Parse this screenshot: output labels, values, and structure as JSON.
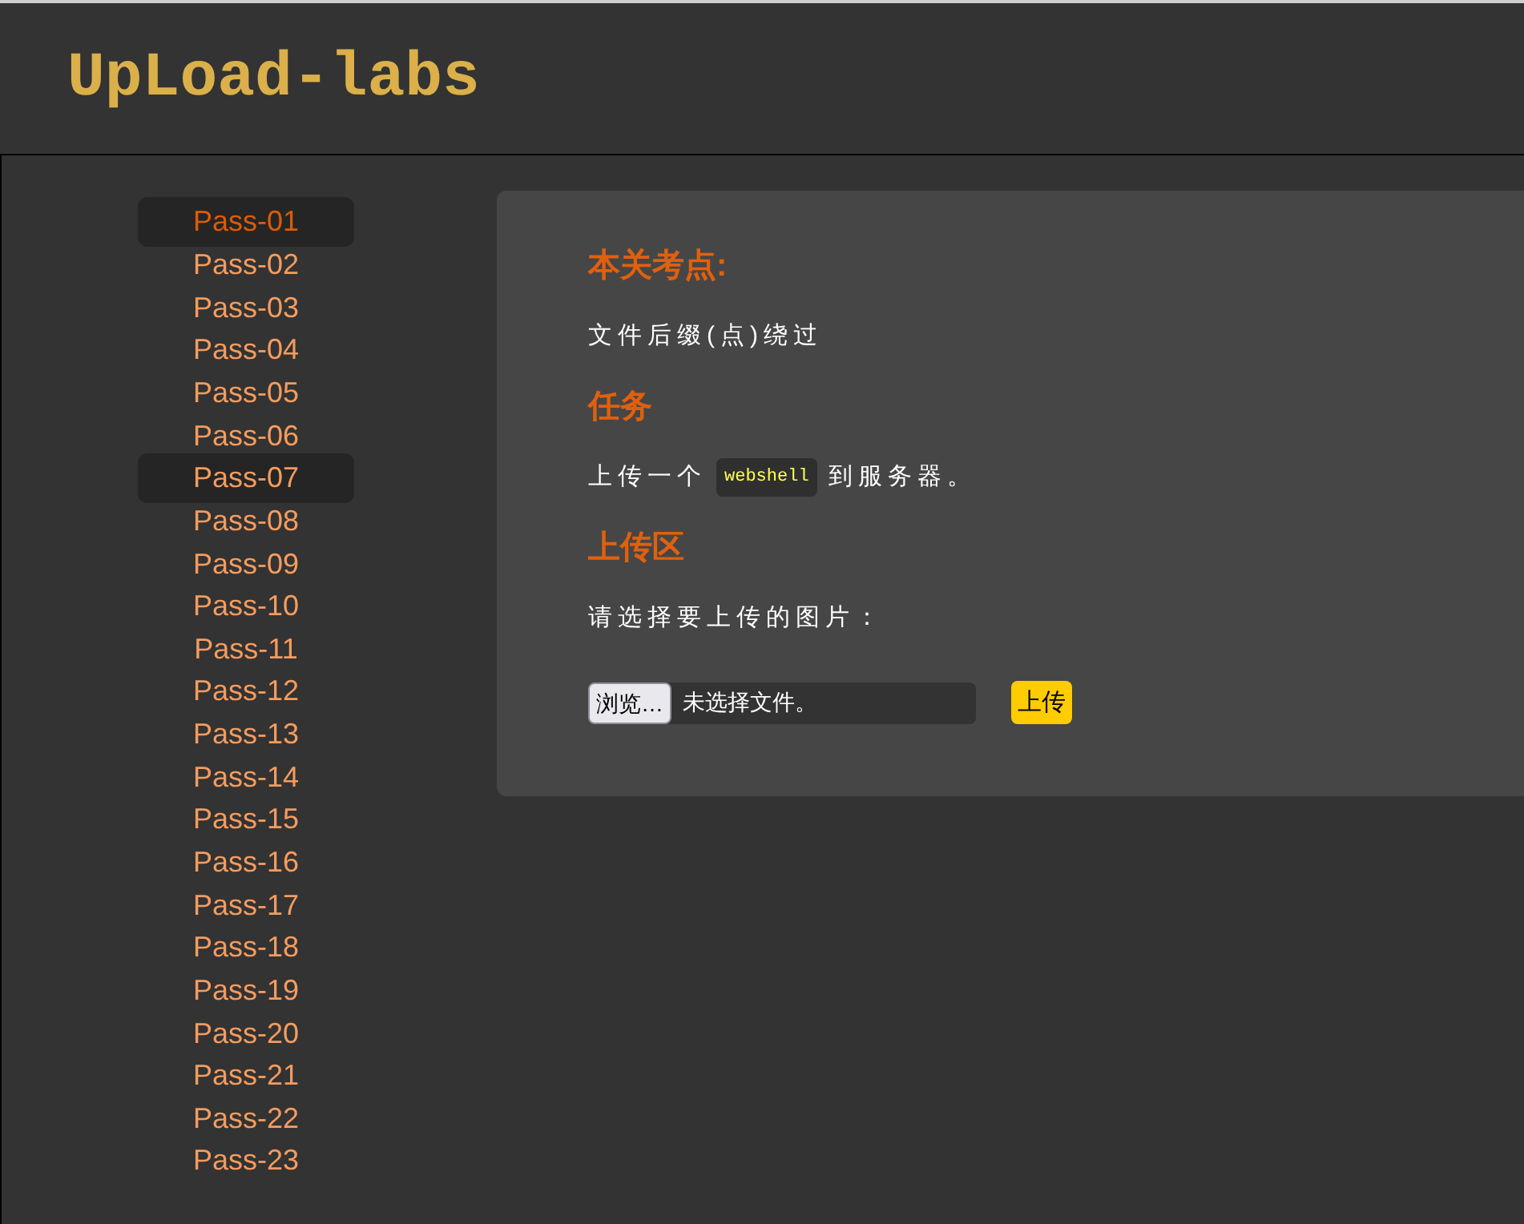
{
  "header": {
    "logo": "UpLoad-labs"
  },
  "sidebar": {
    "items": [
      {
        "label": "Pass-01",
        "selected": true,
        "hovered": false
      },
      {
        "label": "Pass-02",
        "selected": false,
        "hovered": false
      },
      {
        "label": "Pass-03",
        "selected": false,
        "hovered": false
      },
      {
        "label": "Pass-04",
        "selected": false,
        "hovered": false
      },
      {
        "label": "Pass-05",
        "selected": false,
        "hovered": false
      },
      {
        "label": "Pass-06",
        "selected": false,
        "hovered": false
      },
      {
        "label": "Pass-07",
        "selected": false,
        "hovered": true
      },
      {
        "label": "Pass-08",
        "selected": false,
        "hovered": false
      },
      {
        "label": "Pass-09",
        "selected": false,
        "hovered": false
      },
      {
        "label": "Pass-10",
        "selected": false,
        "hovered": false
      },
      {
        "label": "Pass-11",
        "selected": false,
        "hovered": false
      },
      {
        "label": "Pass-12",
        "selected": false,
        "hovered": false
      },
      {
        "label": "Pass-13",
        "selected": false,
        "hovered": false
      },
      {
        "label": "Pass-14",
        "selected": false,
        "hovered": false
      },
      {
        "label": "Pass-15",
        "selected": false,
        "hovered": false
      },
      {
        "label": "Pass-16",
        "selected": false,
        "hovered": false
      },
      {
        "label": "Pass-17",
        "selected": false,
        "hovered": false
      },
      {
        "label": "Pass-18",
        "selected": false,
        "hovered": false
      },
      {
        "label": "Pass-19",
        "selected": false,
        "hovered": false
      },
      {
        "label": "Pass-20",
        "selected": false,
        "hovered": false
      },
      {
        "label": "Pass-21",
        "selected": false,
        "hovered": false
      },
      {
        "label": "Pass-22",
        "selected": false,
        "hovered": false
      },
      {
        "label": "Pass-23",
        "selected": false,
        "hovered": false
      }
    ]
  },
  "panel": {
    "point_heading": "本关考点:",
    "point_text": "文件后缀(点)绕过",
    "task_heading": "任务",
    "task_text": {
      "before": "上传一个",
      "code": "webshell",
      "after": "到服务器。"
    },
    "upload_heading": "上传区",
    "upload_prompt": "请选择要上传的图片：",
    "file_input": {
      "button": "浏览…",
      "status": "未选择文件。"
    },
    "submit_button": "上传"
  }
}
